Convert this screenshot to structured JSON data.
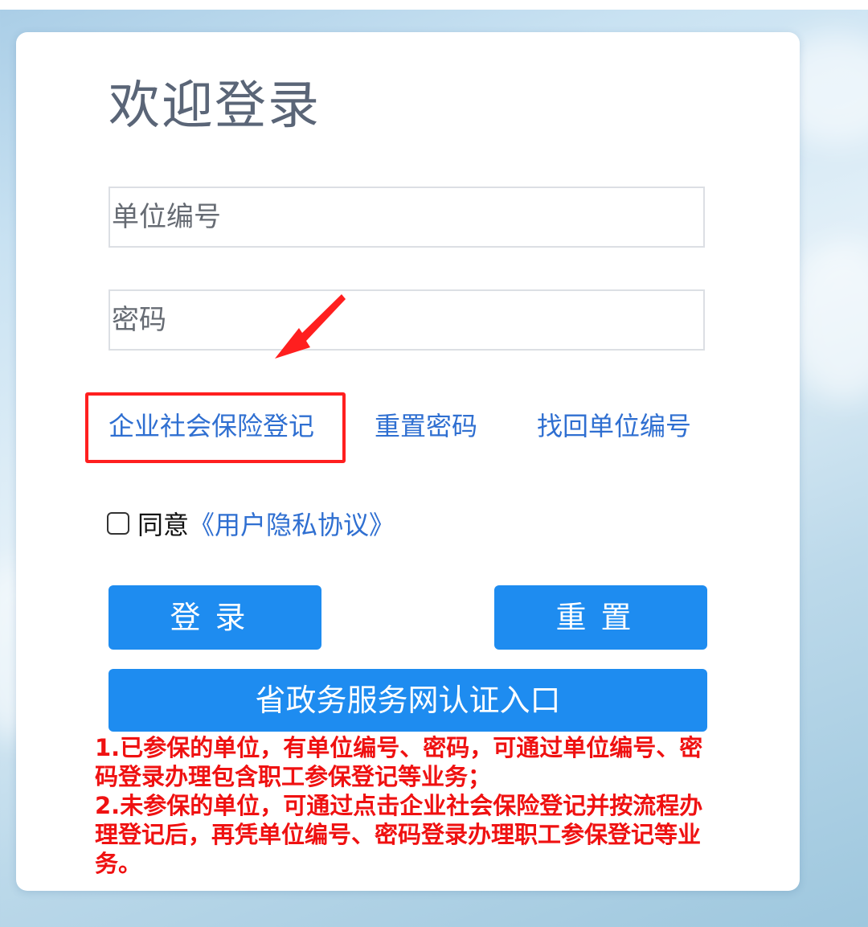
{
  "page": {
    "title": "欢迎登录"
  },
  "form": {
    "username_placeholder": "单位编号",
    "password_placeholder": "密码"
  },
  "links": {
    "register": "企业社会保险登记",
    "reset_password": "重置密码",
    "find_unit_id": "找回单位编号"
  },
  "agreement": {
    "checked": false,
    "label": "同意",
    "link": "《用户隐私协议》"
  },
  "buttons": {
    "login": "登录",
    "reset": "重置",
    "gov_portal": "省政务服务网认证入口"
  },
  "notice": {
    "line1": "1.已参保的单位，有单位编号、密码，可通过单位编号、密码登录办理包含职工参保登记等业务；",
    "line2": "2.未参保的单位，可通过点击企业社会保险登记并按流程办理登记后，再凭单位编号、密码登录办理职工参保登记等业务。"
  },
  "colors": {
    "primary_button": "#1e8cf0",
    "link": "#2f6fd1",
    "annotation_red": "#ff1f1f",
    "notice_text": "#ef1111",
    "title_text": "#5a6577"
  },
  "icons": {
    "annotation_arrow": "red-arrow-icon"
  }
}
